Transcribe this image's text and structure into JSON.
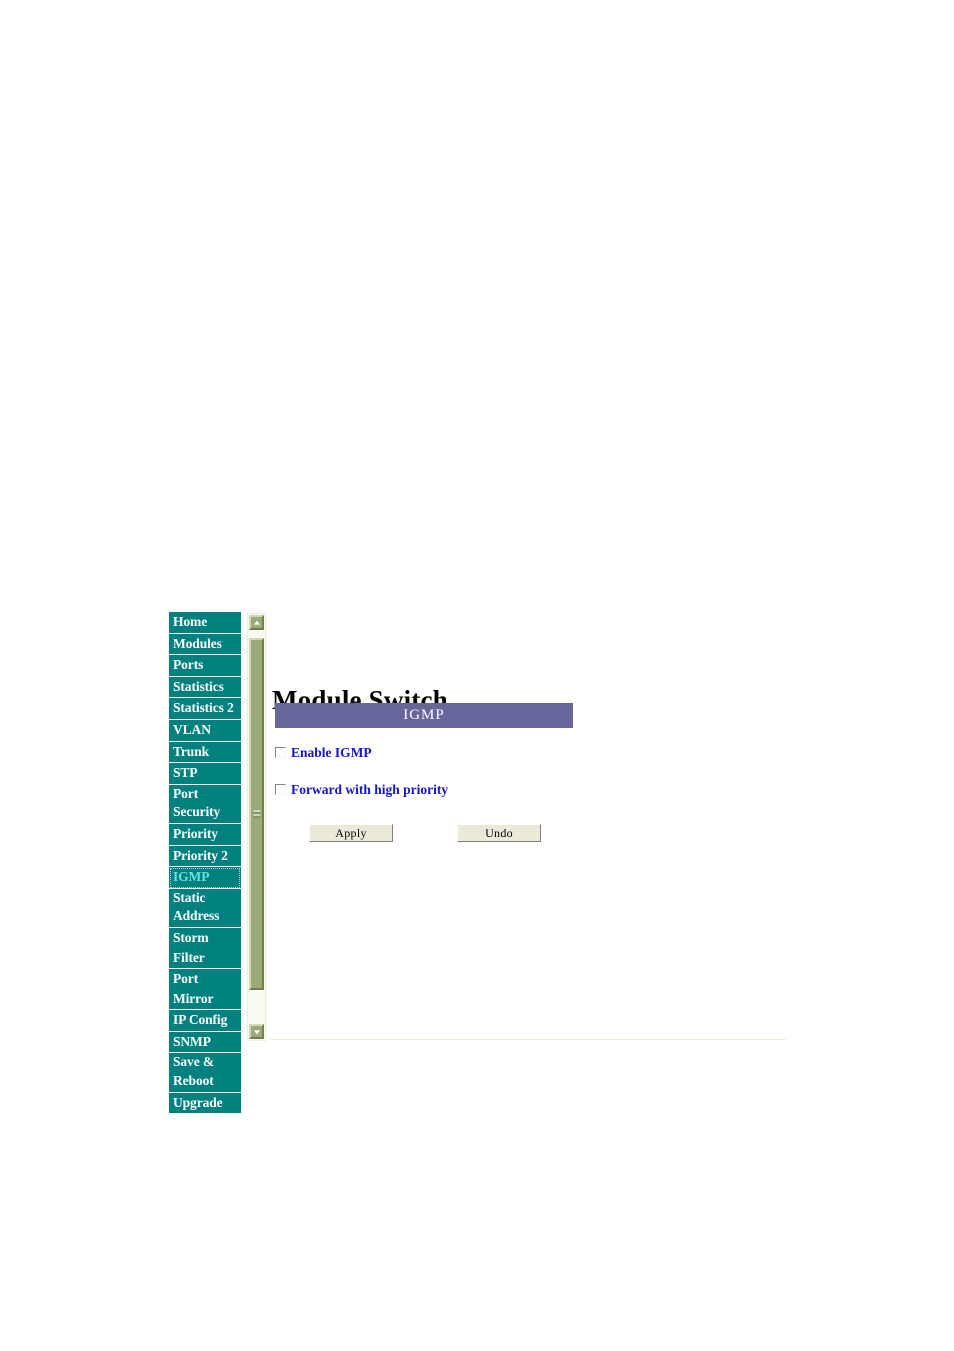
{
  "sidebar": {
    "items": [
      {
        "label": "Home",
        "selected": false,
        "two_line": false
      },
      {
        "label": "Modules",
        "selected": false,
        "two_line": false
      },
      {
        "label": "Ports",
        "selected": false,
        "two_line": false
      },
      {
        "label": "Statistics",
        "selected": false,
        "two_line": false
      },
      {
        "label": "Statistics 2",
        "selected": false,
        "two_line": false
      },
      {
        "label": "VLAN",
        "selected": false,
        "two_line": false
      },
      {
        "label": "Trunk",
        "selected": false,
        "two_line": false
      },
      {
        "label": "STP",
        "selected": false,
        "two_line": false
      },
      {
        "label": "Port\nSecurity",
        "selected": false,
        "two_line": true
      },
      {
        "label": "Priority",
        "selected": false,
        "two_line": false
      },
      {
        "label": "Priority 2",
        "selected": false,
        "two_line": false
      },
      {
        "label": "IGMP",
        "selected": true,
        "two_line": false
      },
      {
        "label": "Static\nAddress",
        "selected": false,
        "two_line": true
      },
      {
        "label": "Storm Filter",
        "selected": false,
        "two_line": false
      },
      {
        "label": "Port Mirror",
        "selected": false,
        "two_line": false
      },
      {
        "label": "IP Config",
        "selected": false,
        "two_line": false
      },
      {
        "label": "SNMP",
        "selected": false,
        "two_line": false
      },
      {
        "label": "Save &\nReboot",
        "selected": false,
        "two_line": true
      },
      {
        "label": "Upgrade",
        "selected": false,
        "two_line": false
      }
    ]
  },
  "scrollbar": {
    "up_arrow": "scroll-up-icon",
    "down_arrow": "scroll-down-icon",
    "grip": "scrollbar-grip-icon"
  },
  "main": {
    "page_title": "Module Switch",
    "section_band_label": "IGMP",
    "options": [
      {
        "label": "Enable IGMP",
        "checked": false
      },
      {
        "label": "Forward with high priority",
        "checked": false
      }
    ],
    "buttons": {
      "apply_label": "Apply",
      "undo_label": "Undo"
    }
  },
  "colors": {
    "sidebar_bg": "#00807f",
    "sidebar_text": "#ffffff",
    "sidebar_selected_text": "#66e0e0",
    "band_bg": "#66669a",
    "band_text": "#ffffff",
    "option_label": "#1414cc",
    "scrollbar_thumb": "#9bab78",
    "scrollbar_track": "#fbfbf4",
    "button_face": "#ece9d8",
    "rule": "#eeecdc",
    "page_bg": "#ffffff"
  }
}
